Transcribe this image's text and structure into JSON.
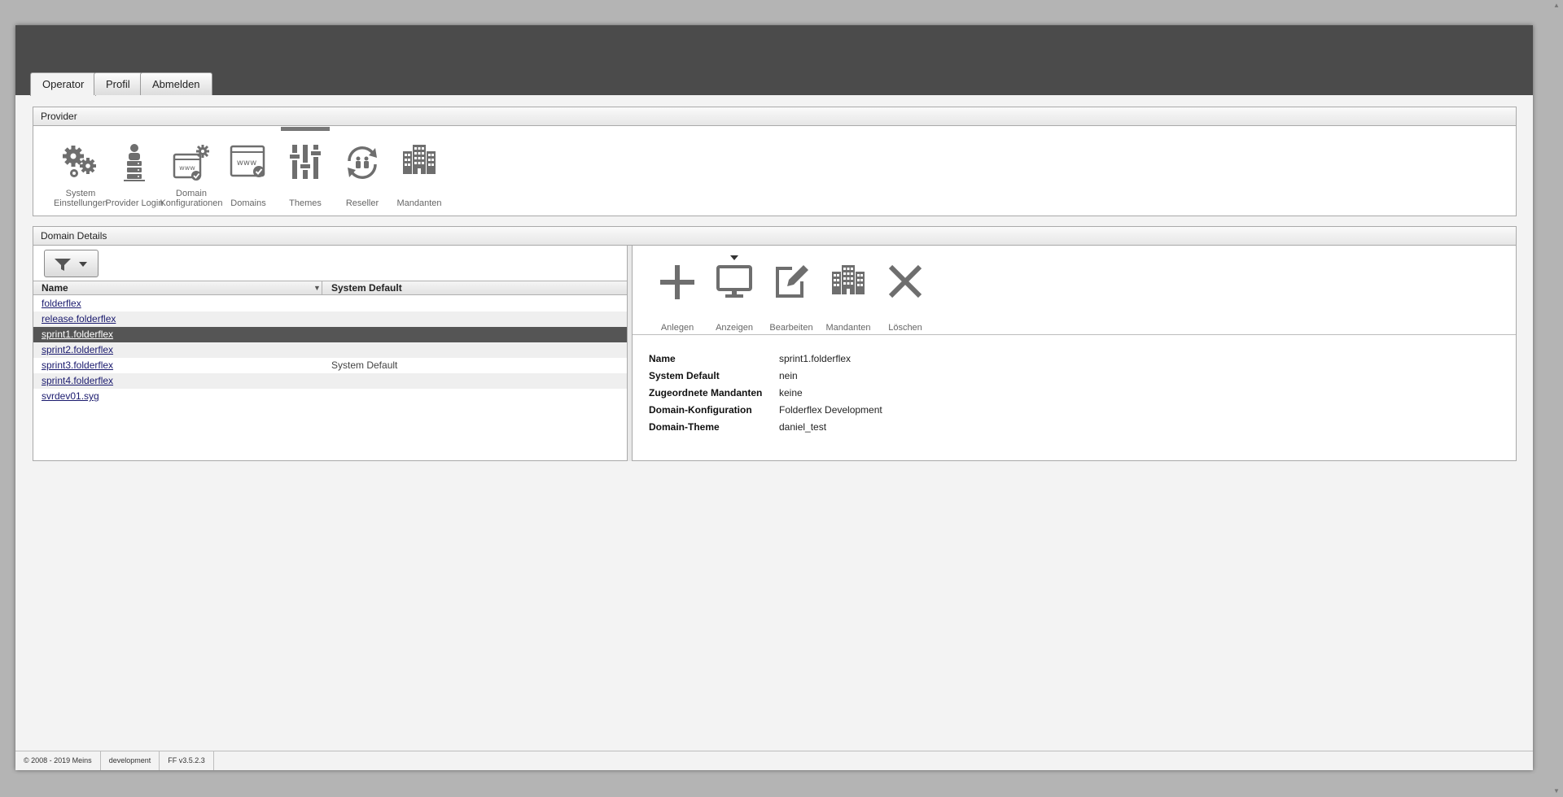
{
  "tabs": [
    {
      "label": "Operator",
      "active": true
    },
    {
      "label": "Profil",
      "active": false
    },
    {
      "label": "Abmelden",
      "active": false
    }
  ],
  "provider": {
    "title": "Provider",
    "items": [
      {
        "label": "System\nEinstellungen",
        "icon": "gears-icon"
      },
      {
        "label": "Provider Login",
        "icon": "user-server-icon"
      },
      {
        "label": "Domain\nKonfigurationen",
        "icon": "www-settings-icon"
      },
      {
        "label": "Domains",
        "icon": "www-check-icon"
      },
      {
        "label": "Themes",
        "icon": "sliders-icon",
        "active": true
      },
      {
        "label": "Reseller",
        "icon": "reseller-cycle-icon"
      },
      {
        "label": "Mandanten",
        "icon": "buildings-icon"
      }
    ]
  },
  "details": {
    "title": "Domain Details",
    "columns": {
      "name": "Name",
      "system_default": "System Default"
    },
    "rows": [
      {
        "name": "folderflex",
        "system_default": ""
      },
      {
        "name": "release.folderflex",
        "system_default": ""
      },
      {
        "name": "sprint1.folderflex",
        "system_default": "",
        "selected": true
      },
      {
        "name": "sprint2.folderflex",
        "system_default": ""
      },
      {
        "name": "sprint3.folderflex",
        "system_default": "System Default"
      },
      {
        "name": "sprint4.folderflex",
        "system_default": ""
      },
      {
        "name": "svrdev01.syg",
        "system_default": ""
      }
    ],
    "toolbar": [
      {
        "label": "Anlegen",
        "icon": "plus-icon"
      },
      {
        "label": "Anzeigen",
        "icon": "monitor-icon",
        "active": true
      },
      {
        "label": "Bearbeiten",
        "icon": "edit-icon"
      },
      {
        "label": "Mandanten",
        "icon": "buildings-icon"
      },
      {
        "label": "Löschen",
        "icon": "close-icon"
      }
    ],
    "fields": [
      {
        "key": "Name",
        "value": "sprint1.folderflex"
      },
      {
        "key": "System Default",
        "value": "nein"
      },
      {
        "key": "Zugeordnete Mandanten",
        "value": "keine"
      },
      {
        "key": "Domain-Konfiguration",
        "value": "Folderflex Development"
      },
      {
        "key": "Domain-Theme",
        "value": "daniel_test"
      }
    ]
  },
  "footer": {
    "copyright": "© 2008 - 2019 Meins",
    "environment": "development",
    "version": "FF v3.5.2.3"
  },
  "colors": {
    "topbar": "#4b4b4b",
    "selected_row": "#555555",
    "icon": "#6e6e6e"
  }
}
